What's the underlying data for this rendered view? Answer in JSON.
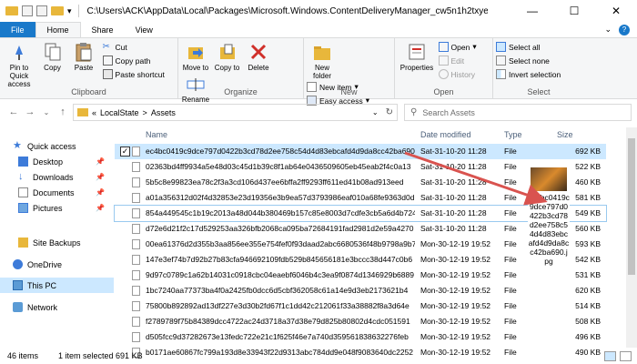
{
  "window": {
    "title": "C:\\Users\\ACK\\AppData\\Local\\Packages\\Microsoft.Windows.ContentDeliveryManager_cw5n1h2txyewy\\Loca",
    "minimize": "—",
    "maximize": "☐",
    "close": "✕"
  },
  "tabs": [
    {
      "label": "File"
    },
    {
      "label": "Home"
    },
    {
      "label": "Share"
    },
    {
      "label": "View"
    }
  ],
  "ribbon": {
    "clipboard": {
      "label": "Clipboard",
      "pin": "Pin to Quick access",
      "copy": "Copy",
      "paste": "Paste",
      "cut": "Cut",
      "copy_path": "Copy path",
      "paste_shortcut": "Paste shortcut"
    },
    "organize": {
      "label": "Organize",
      "move_to": "Move to",
      "copy_to": "Copy to",
      "delete": "Delete",
      "rename": "Rename"
    },
    "new": {
      "label": "New",
      "new_folder": "New folder",
      "new_item": "New item",
      "easy_access": "Easy access"
    },
    "open": {
      "label": "Open",
      "properties": "Properties",
      "open": "Open",
      "edit": "Edit",
      "history": "History"
    },
    "select": {
      "label": "Select",
      "select_all": "Select all",
      "select_none": "Select none",
      "invert": "Invert selection"
    }
  },
  "address": {
    "prefix": "«",
    "crumb1": "LocalState",
    "sep": ">",
    "crumb2": "Assets",
    "search_placeholder": "Search Assets"
  },
  "sidebar": {
    "items": [
      {
        "label": "Quick access"
      },
      {
        "label": "Desktop"
      },
      {
        "label": "Downloads"
      },
      {
        "label": "Documents"
      },
      {
        "label": "Pictures"
      },
      {
        "label": "Site Backups"
      },
      {
        "label": "OneDrive"
      },
      {
        "label": "This PC"
      },
      {
        "label": "Network"
      }
    ]
  },
  "columns": {
    "name": "Name",
    "date": "Date modified",
    "type": "Type",
    "size": "Size"
  },
  "files": [
    {
      "name": "ec4bc0419c9dce797d0422b3cd78d2ee758c54d4d83ebcafd4d9da8cc42ba690",
      "date": "Sat-31-10-20 11:28",
      "type": "File",
      "size": "692 KB"
    },
    {
      "name": "02363bd4ff9934a5e48d03c45d1b39c8f1ab64e0436509605eb45eab2f4c0a13",
      "date": "Sat-31-10-20 11:28",
      "type": "File",
      "size": "522 KB"
    },
    {
      "name": "5b5c8e99823ea78c2f3a3cd106d437ee6bffa2ff9293ff611ed41b08ad913eed",
      "date": "Sat-31-10-20 11:28",
      "type": "File",
      "size": "460 KB"
    },
    {
      "name": "a01a356312d02f4d32853e23d19356e3b9ea57d3793986eaf010a68fe9363d0d",
      "date": "Sat-31-10-20 11:28",
      "type": "File",
      "size": "581 KB"
    },
    {
      "name": "854a449545c1b19c2013a48d044b380469b157c85e8003d7cdfe3cb5a6d4b724",
      "date": "Sat-31-10-20 11:28",
      "type": "File",
      "size": "549 KB"
    },
    {
      "name": "d72e6d21f2c17d529253aa326bfb2068ca095ba72684191fad2981d2e59a4270",
      "date": "Sat-31-10-20 11:28",
      "type": "File",
      "size": "560 KB"
    },
    {
      "name": "00ea61376d2d355b3aa856ee355e754fef0f93daad2abc6680536f48b9798a9b7",
      "date": "Mon-30-12-19 19:52",
      "type": "File",
      "size": "593 KB"
    },
    {
      "name": "147e3ef74b7d92b27b83cfa946692109fdb529b845656181e3bccc38d447c0b6",
      "date": "Mon-30-12-19 19:52",
      "type": "File",
      "size": "542 KB"
    },
    {
      "name": "9d97c0789c1a62b14031c0918cbc04eaebf6046b4c3ea9f0874d1346929b6889",
      "date": "Mon-30-12-19 19:52",
      "type": "File",
      "size": "531 KB"
    },
    {
      "name": "1bc7240aa77373ba4f0a2425fb0dcc6d5cbf362058c61a14e9d3eb2173621b4",
      "date": "Mon-30-12-19 19:52",
      "type": "File",
      "size": "620 KB"
    },
    {
      "name": "75800b892892ad13df227e3d30b2fd67f1c1dd42c212061f33a38882f8a3d64e",
      "date": "Mon-30-12-19 19:52",
      "type": "File",
      "size": "514 KB"
    },
    {
      "name": "f2789789f75b84389dcc4722ac24d3718a37d38e79d825b80802d4cdc051591",
      "date": "Mon-30-12-19 19:52",
      "type": "File",
      "size": "508 KB"
    },
    {
      "name": "d505fcc9d37282673e13fedc722e21c1f625f46e7a740d359561838632276feb",
      "date": "Mon-30-12-19 19:52",
      "type": "File",
      "size": "496 KB"
    },
    {
      "name": "b0171ae60867fc799a193d8e33943f22d9313abc784dd9e048f9083640dc2252",
      "date": "Mon-30-12-19 19:52",
      "type": "File",
      "size": "490 KB"
    }
  ],
  "preview": {
    "label": "ec4bc0419c9dce797d0422b3cd78d2ee758c54d4d83ebcafd4d9da8cc42ba690.jpg"
  },
  "status": {
    "count": "46 items",
    "selected": "1 item selected  691 KB"
  },
  "colors": {
    "accent": "#1979ca",
    "selection": "#cce8ff",
    "arrow": "#d9534f"
  }
}
